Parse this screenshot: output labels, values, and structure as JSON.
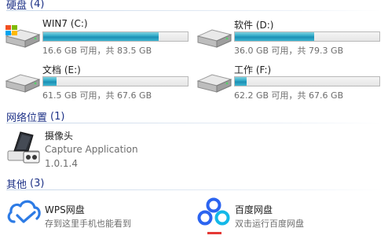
{
  "sections": {
    "hard_disks": {
      "title": "硬盘",
      "count": "(4)"
    },
    "network_locations": {
      "title": "网络位置",
      "count": "(1)"
    },
    "other": {
      "title": "其他",
      "count": "(3)"
    }
  },
  "drives": [
    {
      "name": "WIN7 (C:)",
      "used_fraction": 0.8,
      "info": "16.6 GB 可用，共 83.5 GB",
      "icon": "drive-windows-icon"
    },
    {
      "name": "软件 (D:)",
      "used_fraction": 0.55,
      "info": "36.0 GB 可用，共 79.3 GB",
      "icon": "drive-icon"
    },
    {
      "name": "文档 (E:)",
      "used_fraction": 0.09,
      "info": "61.5 GB 可用，共 67.6 GB",
      "icon": "drive-icon"
    },
    {
      "name": "工作 (F:)",
      "used_fraction": 0.08,
      "info": "62.2 GB 可用，共 67.6 GB",
      "icon": "drive-icon"
    }
  ],
  "network": [
    {
      "name": "摄像头",
      "type": "Capture Application",
      "version": "1.0.1.4",
      "icon": "webcam-icon"
    }
  ],
  "other": [
    {
      "name": "WPS网盘",
      "desc": "存到这里手机也能看到",
      "icon": "wps-cloud-icon"
    },
    {
      "name": "百度网盘",
      "desc": "双击运行百度网盘",
      "icon": "baidu-netdisk-icon"
    }
  ],
  "colors": {
    "section_header": "#1e3287",
    "bar_fill": "#26a0c4",
    "secondary_text": "#6d6d6d",
    "wps_blue": "#2d7be5",
    "baidu_blue": "#2b64f0",
    "baidu_red": "#e53935"
  }
}
